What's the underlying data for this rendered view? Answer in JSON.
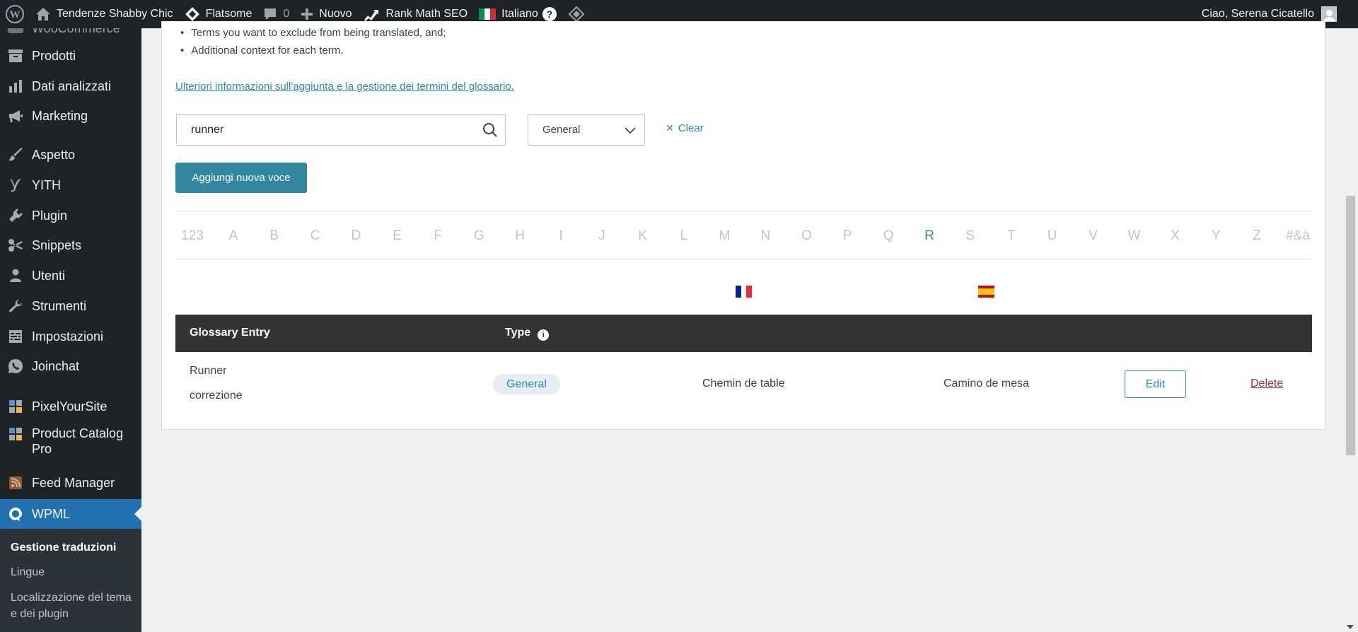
{
  "adminbar": {
    "site_name": "Tendenze Shabby Chic",
    "theme": "Flatsome",
    "comments_count": "0",
    "new_label": "Nuovo",
    "seo_label": "Rank Math SEO",
    "language_label": "Italiano",
    "greeting": "Ciao, Serena Cicatello"
  },
  "sidebar": {
    "items": [
      {
        "label": "Prodotti",
        "icon": "archive-icon"
      },
      {
        "label": "Dati analizzati",
        "icon": "chart-bar-icon"
      },
      {
        "label": "Marketing",
        "icon": "megaphone-icon"
      },
      {
        "label": "Aspetto",
        "icon": "brush-icon"
      },
      {
        "label": "YITH",
        "icon": "yith-icon"
      },
      {
        "label": "Plugin",
        "icon": "plug-icon"
      },
      {
        "label": "Snippets",
        "icon": "scissors-icon"
      },
      {
        "label": "Utenti",
        "icon": "user-icon"
      },
      {
        "label": "Strumenti",
        "icon": "wrench-icon"
      },
      {
        "label": "Impostazioni",
        "icon": "settings-icon"
      },
      {
        "label": "Joinchat",
        "icon": "whatsapp-icon"
      },
      {
        "label": "PixelYourSite",
        "icon": "grid-icon"
      },
      {
        "label": "Product Catalog Pro",
        "icon": "grid-icon"
      },
      {
        "label": "Feed Manager",
        "icon": "rss-icon"
      },
      {
        "label": "WPML",
        "icon": "wpml-icon"
      }
    ],
    "submenu": [
      {
        "label": "Gestione traduzioni"
      },
      {
        "label": "Lingue"
      },
      {
        "label": "Localizzazione del tema e dei plugin"
      }
    ]
  },
  "content": {
    "bullets": [
      "Terms you want to exclude from being translated, and;",
      "Additional context for each term."
    ],
    "info_link": "Ulteriori informazioni sull'aggiunta e la gestione dei termini del glossario.",
    "search_value": "runner",
    "type_filter": "General",
    "clear_label": "Clear",
    "add_button": "Aggiungi nuova voce",
    "alphabet": [
      "123",
      "A",
      "B",
      "C",
      "D",
      "E",
      "F",
      "G",
      "H",
      "I",
      "J",
      "K",
      "L",
      "M",
      "N",
      "O",
      "P",
      "Q",
      "R",
      "S",
      "T",
      "U",
      "V",
      "W",
      "X",
      "Y",
      "Z",
      "#&à"
    ],
    "active_letter": "R",
    "table": {
      "headers": {
        "entry": "Glossary Entry",
        "type": "Type"
      },
      "row": {
        "entry": "Runner",
        "note": "correzione",
        "type": "General",
        "fr": "Chemin de table",
        "es": "Camino de mesa",
        "edit": "Edit",
        "delete": "Delete"
      }
    }
  },
  "colors": {
    "accent": "#33879e",
    "link": "#2a8abd",
    "danger": "#b32d2e",
    "adminbar": "#1d2327",
    "menu_active": "#2271b1"
  }
}
